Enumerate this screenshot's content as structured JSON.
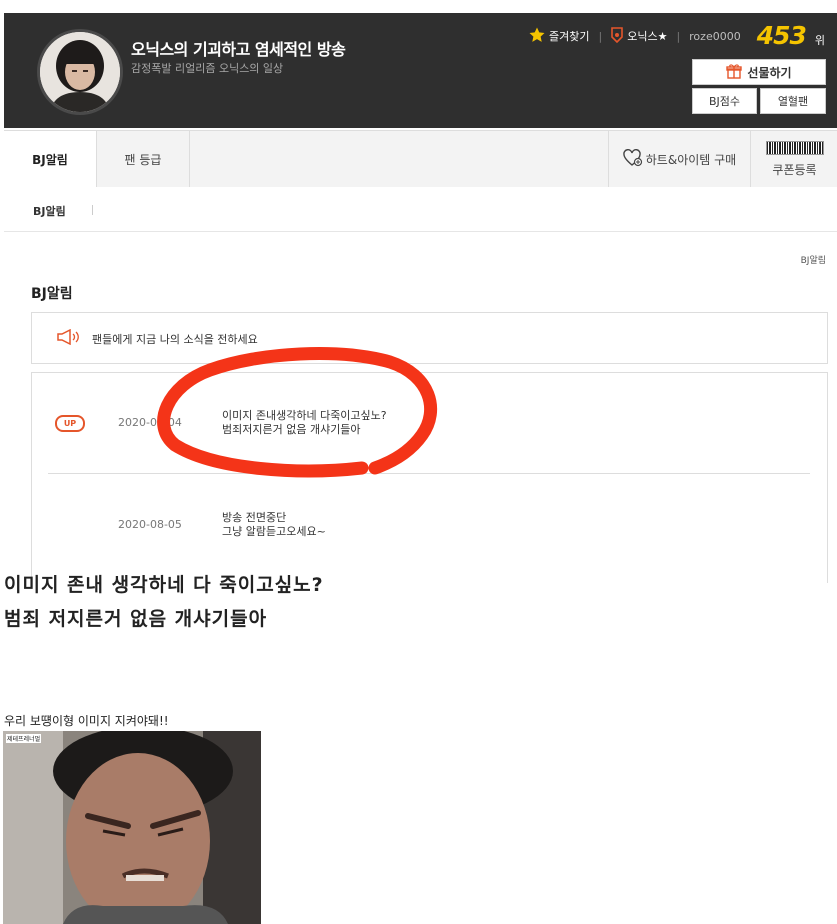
{
  "header": {
    "title": "오닉스의 기괴하고 염세적인 방송",
    "subtitle": "감정폭발 리얼리즘 오닉스의 일상",
    "favorite_label": "즐겨찾기",
    "bj_name": "오닉스★",
    "user_id": "roze0000",
    "rank_number": "453",
    "rank_unit": "위",
    "gift_label": "선물하기",
    "bj_score_label": "BJ점수",
    "fan_label": "열혈팬"
  },
  "tabs": {
    "bj_notice": "BJ알림",
    "fan_grade": "팬 등급",
    "heart_item": "하트&아이템 구매",
    "coupon": "쿠폰등록"
  },
  "subnav": {
    "item": "BJ알림"
  },
  "breadcrumb": "BJ알림",
  "section_title": "BJ알림",
  "notice_prompt": "팬들에게 지금 나의 소식을 전하세요",
  "posts": [
    {
      "badge": "UP",
      "date": "2020-08-04",
      "line1": "이미지 존내생각하네 다죽이고싶노?",
      "line2": "범죄저지른거 없음 개샤기들아"
    },
    {
      "date": "2020-08-05",
      "line1": "방송 전면중단",
      "line2": "그냥 알람듣고오세요~"
    }
  ],
  "captions": {
    "big_line1": "이미지 존내 생각하네 다 죽이고싶노?",
    "big_line2": "범죄 저지른거 없음 개샤기들아",
    "small": "우리 보떙이형 이미지 지켜야돼!!",
    "photo_tag": "제테프레너멀"
  },
  "colors": {
    "header_bg": "#2f2f2f",
    "rank_yellow": "#f5c400",
    "accent_red": "#e5562b",
    "scribble_red": "#f43418"
  }
}
